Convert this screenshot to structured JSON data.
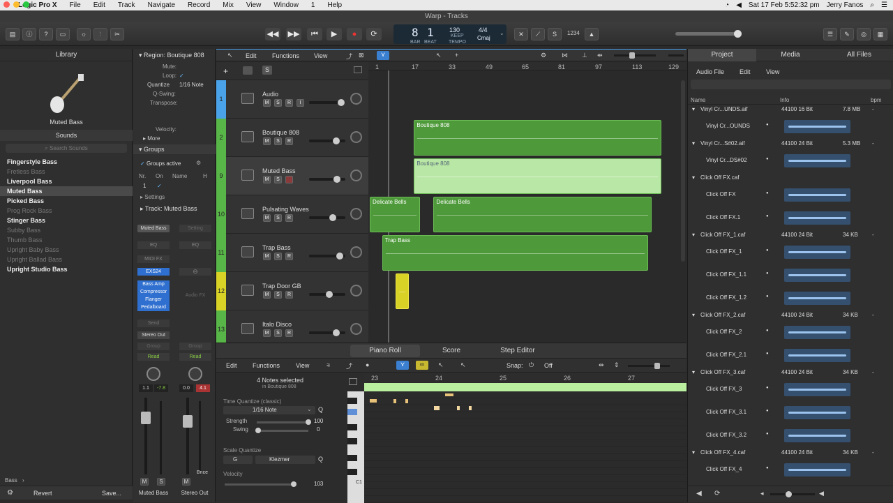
{
  "menubar": {
    "app": "Logic Pro X",
    "items": [
      "File",
      "Edit",
      "Track",
      "Navigate",
      "Record",
      "Mix",
      "View",
      "Window",
      "1",
      "Help"
    ],
    "clock": "Sat 17 Feb  5:52:32 pm",
    "user": "Jerry Fanos"
  },
  "window": {
    "title": "Warp - Tracks"
  },
  "lcd": {
    "bar": "8",
    "beat": "1",
    "bar_label": "BAR",
    "beat_label": "BEAT",
    "tempo": "130",
    "keep": "KEEP",
    "tempo_label": "TEMPO",
    "signature": "4/4",
    "key": "Cmaj",
    "count_in": "1234"
  },
  "library": {
    "title": "Library",
    "patch_name": "Muted Bass",
    "sounds_label": "Sounds",
    "search_placeholder": "Search Sounds",
    "items": [
      {
        "label": "Fingerstyle Bass",
        "dim": false
      },
      {
        "label": "Fretless Bass",
        "dim": true
      },
      {
        "label": "Liverpool Bass",
        "dim": false
      },
      {
        "label": "Muted Bass",
        "dim": false
      },
      {
        "label": "Picked Bass",
        "dim": false
      },
      {
        "label": "Prog Rock Bass",
        "dim": true
      },
      {
        "label": "Stinger Bass",
        "dim": false
      },
      {
        "label": "Subby Bass",
        "dim": true
      },
      {
        "label": "Thumb Bass",
        "dim": true
      },
      {
        "label": "Upright Baby Bass",
        "dim": true
      },
      {
        "label": "Upright Ballad Bass",
        "dim": true
      },
      {
        "label": "Upright Studio Bass",
        "dim": false
      }
    ],
    "footer_path": "Bass",
    "revert": "Revert",
    "save": "Save..."
  },
  "inspector": {
    "region_label": "Region: Boutique 808",
    "mute": "Mute:",
    "loop": "Loop:",
    "loop_check": "✓",
    "quantize": "Quantize",
    "quantize_val": "1/16 Note",
    "qswing": "Q-Swing:",
    "transpose": "Transpose:",
    "velocity": "Velocity:",
    "more": "More",
    "groups": "Groups",
    "groups_active": "Groups active",
    "nr": "Nr.",
    "on": "On",
    "name": "Name",
    "h": "H",
    "row_nr": "1",
    "row_on": "✓",
    "settings": "Settings",
    "track_label": "Track: Muted Bass",
    "strip1": {
      "name_btn": "Muted Bass",
      "eq": "EQ",
      "midi_fx": "MIDI FX",
      "instrument": "EXS24",
      "fx": [
        "Bass Amp",
        "Compressor",
        "Flanger",
        "Pedalboard"
      ],
      "send": "Send",
      "output": "Stereo Out",
      "group": "Group",
      "read": "Read",
      "val1": "1.1",
      "val2": "-7.8",
      "name": "Muted Bass",
      "m": "M",
      "s": "S"
    },
    "strip2": {
      "name_btn": "Setting",
      "eq": "EQ",
      "audio_fx": "Audio FX",
      "output": "",
      "group": "Group",
      "read": "Read",
      "val1": "0.0",
      "val2": "4.1",
      "bnce": "Bnce",
      "name": "Stereo Out",
      "m": "M"
    }
  },
  "tracks_toolbar": {
    "edit": "Edit",
    "functions": "Functions",
    "view": "View"
  },
  "ruler": [
    "1",
    "17",
    "33",
    "49",
    "65",
    "81",
    "97",
    "113",
    "129"
  ],
  "tracks": [
    {
      "num": "1",
      "name": "Audio",
      "color": "#4aa3e8",
      "buttons": [
        "M",
        "S",
        "R",
        "I"
      ],
      "fader": 0.86
    },
    {
      "num": "2",
      "name": "Boutique 808",
      "color": "#58b548",
      "buttons": [
        "M",
        "S",
        "R"
      ],
      "fader": 0.7
    },
    {
      "num": "9",
      "name": "Muted Bass",
      "color": "#58b548",
      "buttons": [
        "M",
        "S"
      ],
      "fader": 0.72,
      "selected": true
    },
    {
      "num": "10",
      "name": "Pulsating Waves",
      "color": "#58b548",
      "buttons": [
        "M",
        "S",
        "R"
      ],
      "fader": 0.6
    },
    {
      "num": "11",
      "name": "Trap Bass",
      "color": "#58b548",
      "buttons": [
        "M",
        "S",
        "R"
      ],
      "fader": 0.82
    },
    {
      "num": "12",
      "name": "Trap Door GB",
      "color": "#d9d226",
      "buttons": [
        "M",
        "S",
        "R"
      ],
      "fader": 0.5
    },
    {
      "num": "13",
      "name": "Italo Disco",
      "color": "#58b548",
      "buttons": [
        "M",
        "S",
        "R"
      ],
      "fader": 0.7
    }
  ],
  "regions": [
    {
      "label": "Boutique 808",
      "row": 1,
      "start": 0.142,
      "end": 0.938,
      "sel": false
    },
    {
      "label": "Boutique 808",
      "row": 2,
      "start": 0.142,
      "end": 0.938,
      "sel": true
    },
    {
      "label": "Delicate Bells",
      "row": 3,
      "start": 0.0,
      "end": 0.162,
      "sel": false
    },
    {
      "label": "Delicate Bells",
      "row": 3,
      "start": 0.205,
      "end": 0.905,
      "sel": false
    },
    {
      "label": "Trap Bass",
      "row": 4,
      "start": 0.04,
      "end": 0.895,
      "sel": false
    },
    {
      "label": "",
      "row": 5,
      "start": 0.082,
      "end": 0.125,
      "sel": false,
      "yellow": true
    }
  ],
  "editor": {
    "tabs": [
      "Piano Roll",
      "Score",
      "Step Editor"
    ],
    "edit": "Edit",
    "functions": "Functions",
    "view": "View",
    "snap_label": "Snap:",
    "snap_val": "Off",
    "notes_selected": "4 Notes selected",
    "in_region": "in Boutique 808",
    "time_quantize": "Time Quantize (classic)",
    "tq_val": "1/16 Note",
    "strength": "Strength",
    "strength_val": "100",
    "swing": "Swing",
    "swing_val": "0",
    "scale_quantize": "Scale Quantize",
    "scale_key": "G",
    "scale_val": "Klezmer",
    "velocity": "Velocity",
    "velocity_val": "103",
    "ruler": [
      "23",
      "24",
      "25",
      "26",
      "27"
    ],
    "c1": "C1"
  },
  "browser": {
    "tabs": [
      "Project",
      "Media",
      "All Files"
    ],
    "audio_file": "Audio File",
    "edit": "Edit",
    "view": "View",
    "col_name": "Name",
    "col_info": "Info",
    "col_bpm": "bpm",
    "files": [
      {
        "name": "Vinyl Cr...UNDS.aif",
        "info": "44100  16 Bit",
        "size": "7.8 MB",
        "region": "Vinyl Cr...OUNDS"
      },
      {
        "name": "Vinyl Cr...S#02.aif",
        "info": "44100  24 Bit",
        "size": "5.3 MB",
        "region": "Vinyl Cr...DS#02"
      },
      {
        "name": "Click Off FX.caf",
        "info": "",
        "size": "",
        "regions": [
          "Click Off FX",
          "Click Off FX.1"
        ]
      },
      {
        "name": "Click Off FX_1.caf",
        "info": "44100  24 Bit",
        "size": "34 KB",
        "regions": [
          "Click Off FX_1",
          "Click Off FX_1.1",
          "Click Off FX_1.2"
        ]
      },
      {
        "name": "Click Off FX_2.caf",
        "info": "44100  24 Bit",
        "size": "34 KB",
        "regions": [
          "Click Off FX_2",
          "Click Off FX_2.1"
        ]
      },
      {
        "name": "Click Off FX_3.caf",
        "info": "44100  24 Bit",
        "size": "34 KB",
        "regions": [
          "Click Off FX_3",
          "Click Off FX_3.1",
          "Click Off FX_3.2"
        ]
      },
      {
        "name": "Click Off FX_4.caf",
        "info": "44100  24 Bit",
        "size": "34 KB",
        "regions": [
          "Click Off FX_4"
        ]
      }
    ]
  }
}
